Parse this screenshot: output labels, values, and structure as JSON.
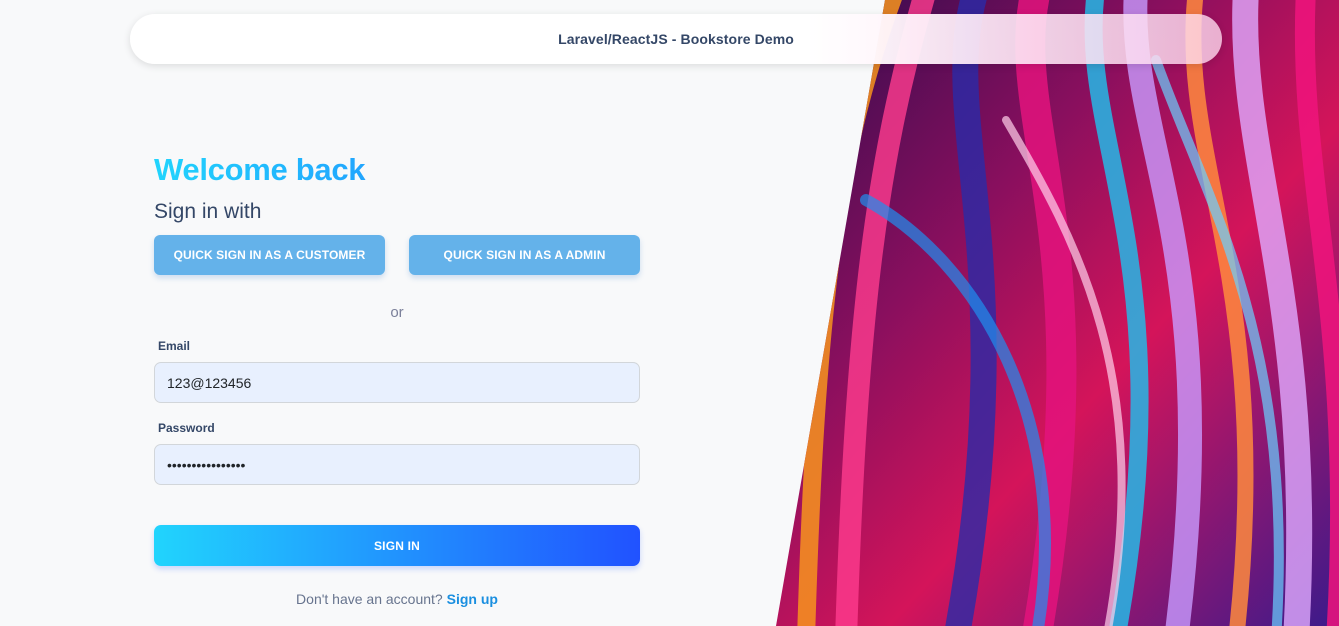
{
  "navbar": {
    "brand": "Laravel/ReactJS - Bookstore Demo"
  },
  "login": {
    "title": "Welcome back",
    "subtitle": "Sign in with",
    "quick_customer_label": "QUICK SIGN IN AS A CUSTOMER",
    "quick_admin_label": "QUICK SIGN IN AS A ADMIN",
    "divider": "or",
    "email_label": "Email",
    "email_value": "123@123456",
    "password_label": "Password",
    "password_value": "1234567890123456",
    "signin_label": "SIGN IN",
    "no_account_text": "Don't have an account?",
    "signup_label": "Sign up"
  },
  "colors": {
    "accent_gradient_start": "#21d4fd",
    "accent_gradient_end": "#2152ff",
    "quick_button": "#64b2ea",
    "input_background": "#e8f0fe",
    "text_dark": "#344767",
    "link": "#1a8fe0"
  },
  "decor": {
    "background_art": "colorful-swirl-image"
  }
}
